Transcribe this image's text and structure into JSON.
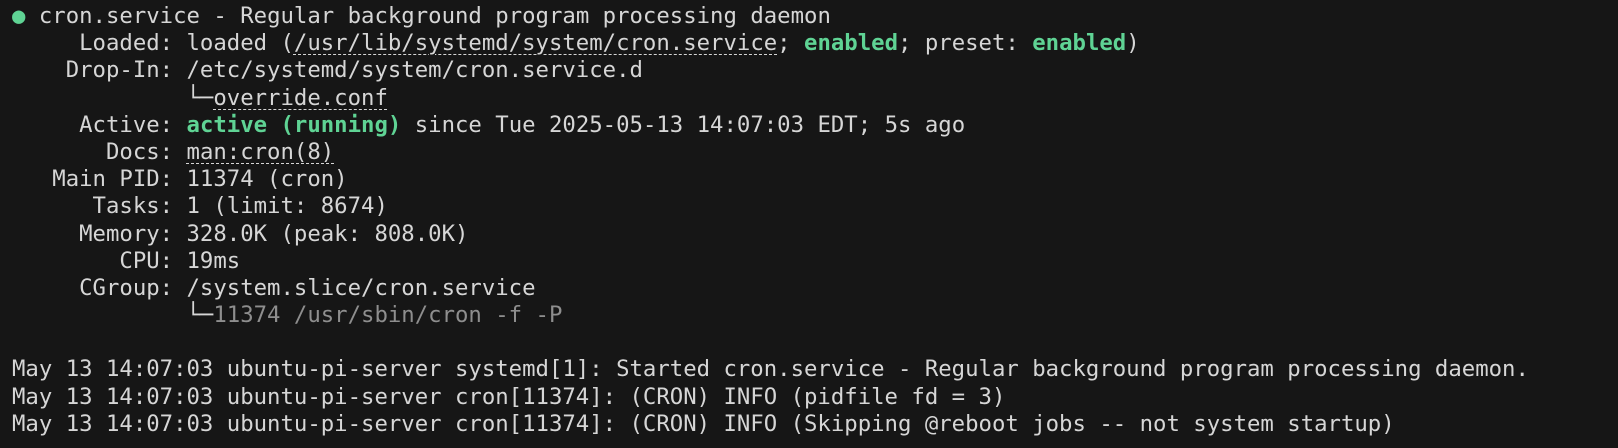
{
  "colors": {
    "background": "#161616",
    "text": "#d6d6d6",
    "active_green": "#5fd394",
    "dim": "#8e8e8e"
  },
  "status_icon": "green-circle-icon",
  "lines": [
    [
      {
        "t": "● ",
        "s": "dot"
      },
      {
        "t": "cron.service - Regular background program processing daemon"
      }
    ],
    [
      {
        "t": "     Loaded: loaded ("
      },
      {
        "t": "/usr/lib/systemd/system/cron.service",
        "s": "ul"
      },
      {
        "t": "; "
      },
      {
        "t": "enabled",
        "s": "green"
      },
      {
        "t": "; preset: "
      },
      {
        "t": "enabled",
        "s": "green"
      },
      {
        "t": ")"
      }
    ],
    [
      {
        "t": "    Drop-In: /etc/systemd/system/cron.service.d"
      }
    ],
    [
      {
        "t": "             └─"
      },
      {
        "t": "override.conf",
        "s": "ul"
      }
    ],
    [
      {
        "t": "     Active: "
      },
      {
        "t": "active (running)",
        "s": "green"
      },
      {
        "t": " since Tue 2025-05-13 14:07:03 EDT; 5s ago"
      }
    ],
    [
      {
        "t": "       Docs: "
      },
      {
        "t": "man:cron(8)",
        "s": "ul"
      }
    ],
    [
      {
        "t": "   Main PID: 11374 (cron)"
      }
    ],
    [
      {
        "t": "      Tasks: 1 (limit: 8674)"
      }
    ],
    [
      {
        "t": "     Memory: 328.0K (peak: 808.0K)"
      }
    ],
    [
      {
        "t": "        CPU: 19ms"
      }
    ],
    [
      {
        "t": "     CGroup: /system.slice/cron.service"
      }
    ],
    [
      {
        "t": "             └─"
      },
      {
        "t": "11374 /usr/sbin/cron -f -P",
        "s": "dim"
      }
    ],
    [
      {
        "t": ""
      }
    ],
    [
      {
        "t": "May 13 14:07:03 ubuntu-pi-server systemd[1]: Started cron.service - Regular background program processing daemon."
      }
    ],
    [
      {
        "t": "May 13 14:07:03 ubuntu-pi-server cron[11374]: (CRON) INFO (pidfile fd = 3)"
      }
    ],
    [
      {
        "t": "May 13 14:07:03 ubuntu-pi-server cron[11374]: (CRON) INFO (Skipping @reboot jobs -- not system startup)"
      }
    ]
  ]
}
